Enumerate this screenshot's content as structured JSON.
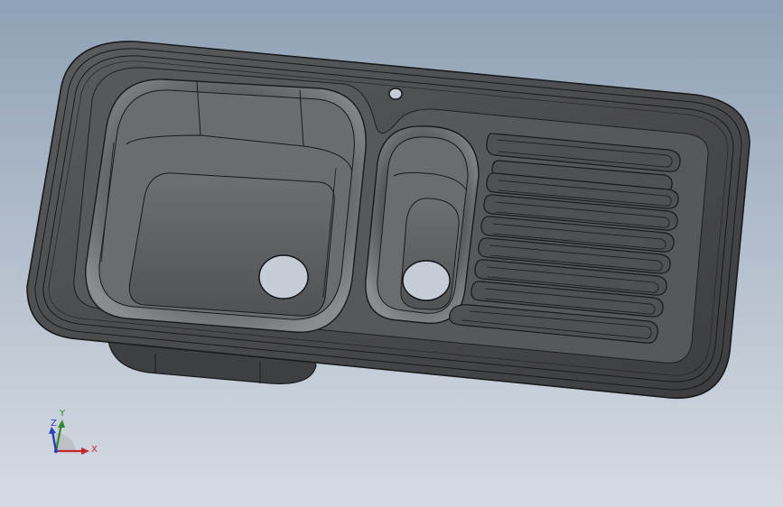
{
  "viewport": {
    "model": "sink",
    "background_top": "#8fa1b6",
    "background_bottom": "#d5dbe3"
  },
  "triad": {
    "x_label": "X",
    "y_label": "Y",
    "z_label": "Z",
    "x_color": "#c0282d",
    "y_color": "#2f8a35",
    "z_color": "#2a3fb5"
  }
}
